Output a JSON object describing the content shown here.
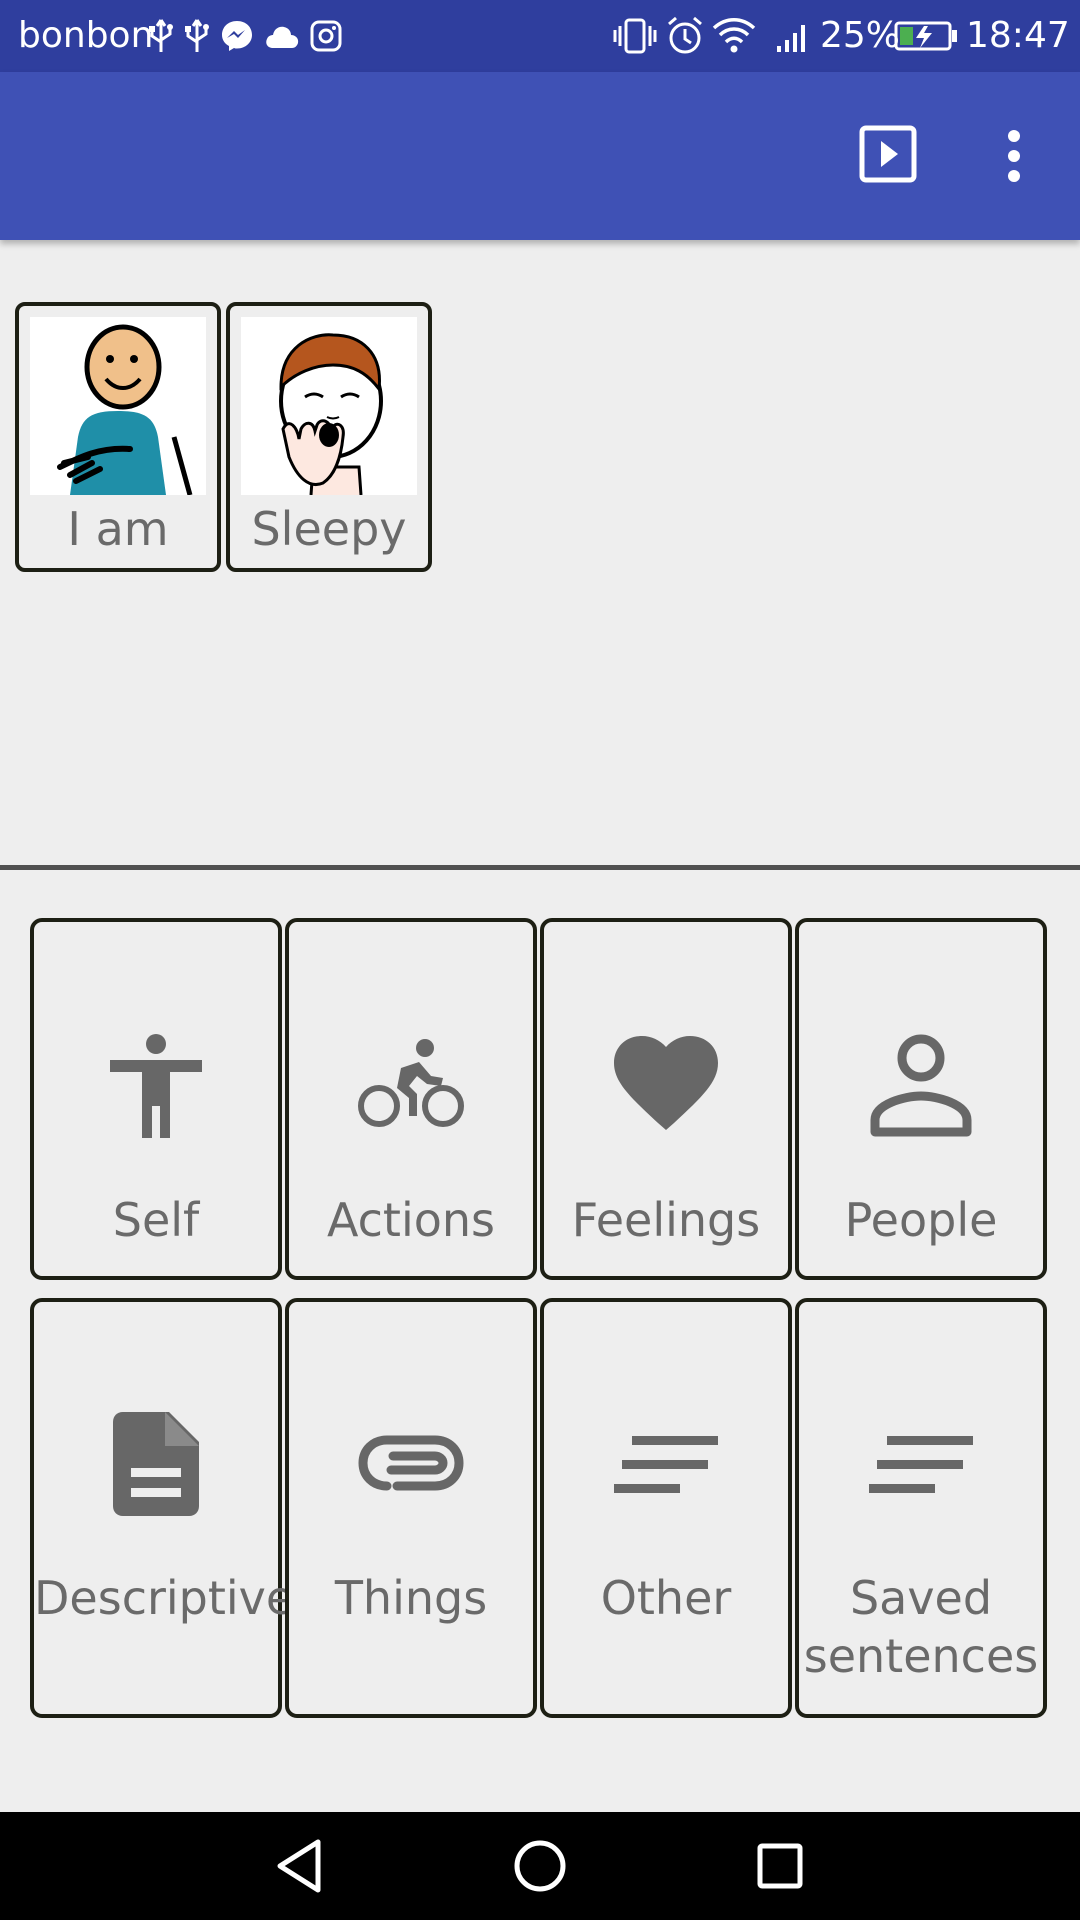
{
  "status_bar": {
    "carrier": "bonbon",
    "battery_percent": "25%",
    "time": "18:47",
    "icons": [
      "usb-icon",
      "usb-icon",
      "messenger-icon",
      "cloud-icon",
      "instagram-icon",
      "vibrate-icon",
      "alarm-icon",
      "wifi-icon",
      "signal-icon",
      "battery-charging-icon"
    ]
  },
  "app_bar": {
    "actions": [
      "play-icon",
      "more-vert-icon"
    ],
    "accent_color": "#3f51b5",
    "status_color": "#2f3e9e"
  },
  "sentence": {
    "words": [
      {
        "label": "I am",
        "picture": "person-self-pictogram"
      },
      {
        "label": "Sleepy",
        "picture": "sleepy-yawning-pictogram"
      }
    ]
  },
  "categories": [
    {
      "label": "Self",
      "icon": "accessibility-icon"
    },
    {
      "label": "Actions",
      "icon": "bike-icon"
    },
    {
      "label": "Feelings",
      "icon": "heart-icon"
    },
    {
      "label": "People",
      "icon": "person-outline-icon"
    },
    {
      "label": "Descriptive",
      "icon": "document-icon"
    },
    {
      "label": "Things",
      "icon": "paperclip-icon"
    },
    {
      "label": "Other",
      "icon": "short-text-icon"
    },
    {
      "label_line1": "Saved",
      "label_line2": "sentences",
      "icon": "short-text-icon"
    }
  ],
  "nav_bar": {
    "buttons": [
      "back-icon",
      "home-icon",
      "recents-icon"
    ]
  }
}
